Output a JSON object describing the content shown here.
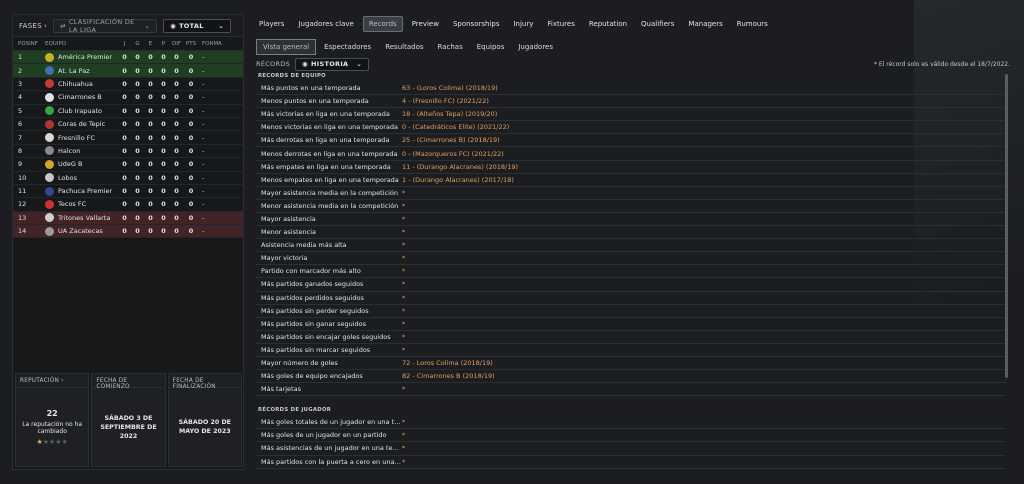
{
  "left": {
    "fases_label": "FASES",
    "stage_dropdown": "CLASIFICACIÓN DE LA LIGA",
    "total_dropdown": "TOTAL",
    "columns": [
      "POS",
      "INF",
      "EQUIPO",
      "J",
      "G",
      "E",
      "P",
      "DIF",
      "PTS",
      "FORMA"
    ],
    "rows": [
      {
        "pos": "1",
        "team": "América Premier",
        "j": "0",
        "g": "0",
        "e": "0",
        "p": "0",
        "dif": "0",
        "pts": "0",
        "form": "-",
        "zone": "green",
        "crest": "#c8b02a"
      },
      {
        "pos": "2",
        "team": "At. La Paz",
        "j": "0",
        "g": "0",
        "e": "0",
        "p": "0",
        "dif": "0",
        "pts": "0",
        "form": "-",
        "zone": "green",
        "crest": "#3f6fb5"
      },
      {
        "pos": "3",
        "team": "Chihuahua",
        "j": "0",
        "g": "0",
        "e": "0",
        "p": "0",
        "dif": "0",
        "pts": "0",
        "form": "-",
        "zone": "",
        "crest": "#c23a3a"
      },
      {
        "pos": "4",
        "team": "Cimarrones B",
        "j": "0",
        "g": "0",
        "e": "0",
        "p": "0",
        "dif": "0",
        "pts": "0",
        "form": "-",
        "zone": "",
        "crest": "#e0e0e0"
      },
      {
        "pos": "5",
        "team": "Club Irapuato",
        "j": "0",
        "g": "0",
        "e": "0",
        "p": "0",
        "dif": "0",
        "pts": "0",
        "form": "-",
        "zone": "",
        "crest": "#3aa04a"
      },
      {
        "pos": "6",
        "team": "Coras de Tepic",
        "j": "0",
        "g": "0",
        "e": "0",
        "p": "0",
        "dif": "0",
        "pts": "0",
        "form": "-",
        "zone": "",
        "crest": "#b0342f"
      },
      {
        "pos": "7",
        "team": "Fresnillo FC",
        "j": "0",
        "g": "0",
        "e": "0",
        "p": "0",
        "dif": "0",
        "pts": "0",
        "form": "-",
        "zone": "",
        "crest": "#d9d9d9"
      },
      {
        "pos": "8",
        "team": "Halcon",
        "j": "0",
        "g": "0",
        "e": "0",
        "p": "0",
        "dif": "0",
        "pts": "0",
        "form": "-",
        "zone": "",
        "crest": "#8a8a8a"
      },
      {
        "pos": "9",
        "team": "UdeG B",
        "j": "0",
        "g": "0",
        "e": "0",
        "p": "0",
        "dif": "0",
        "pts": "0",
        "form": "-",
        "zone": "",
        "crest": "#d4a32b"
      },
      {
        "pos": "10",
        "team": "Lobos",
        "j": "0",
        "g": "0",
        "e": "0",
        "p": "0",
        "dif": "0",
        "pts": "0",
        "form": "-",
        "zone": "",
        "crest": "#c9c9c9"
      },
      {
        "pos": "11",
        "team": "Pachuca Premier",
        "j": "0",
        "g": "0",
        "e": "0",
        "p": "0",
        "dif": "0",
        "pts": "0",
        "form": "-",
        "zone": "",
        "crest": "#2e4a8c"
      },
      {
        "pos": "12",
        "team": "Tecos FC",
        "j": "0",
        "g": "0",
        "e": "0",
        "p": "0",
        "dif": "0",
        "pts": "0",
        "form": "-",
        "zone": "",
        "crest": "#c8332f"
      },
      {
        "pos": "13",
        "team": "Tritones Vallarta",
        "j": "0",
        "g": "0",
        "e": "0",
        "p": "0",
        "dif": "0",
        "pts": "0",
        "form": "-",
        "zone": "red",
        "crest": "#d0d0d0"
      },
      {
        "pos": "14",
        "team": "UA Zacatecas",
        "j": "0",
        "g": "0",
        "e": "0",
        "p": "0",
        "dif": "0",
        "pts": "0",
        "form": "-",
        "zone": "red",
        "crest": "#9b9b9b"
      }
    ],
    "reputation": {
      "title": "REPUTACIÓN",
      "value": "22",
      "text": "La reputación no ha cambiado",
      "stars_filled": 1,
      "stars_total": 5
    },
    "start": {
      "title": "FECHA DE COMIENZO",
      "value": "SÁBADO 3 DE SEPTIEMBRE DE 2022"
    },
    "end": {
      "title": "FECHA DE FINALIZACIÓN",
      "value": "SÁBADO 20 DE MAYO DE 2023"
    }
  },
  "tabs": [
    "Players",
    "Jugadores clave",
    "Records",
    "Preview",
    "Sponsorships",
    "Injury",
    "Fixtures",
    "Reputation",
    "Qualifiers",
    "Managers",
    "Rumours"
  ],
  "active_tab": 2,
  "subtabs": [
    "Vista general",
    "Espectadores",
    "Resultados",
    "Rachas",
    "Equipos",
    "Jugadores"
  ],
  "active_subtab": 0,
  "records_bar": {
    "label": "RÉCORDS",
    "dropdown": "HISTORIA",
    "note": "* El récord solo es válido desde el 18/7/2022."
  },
  "team_section": "RÉCORDS DE EQUIPO",
  "team_records": [
    {
      "label": "Más puntos en una temporada",
      "value": "63 - (Loros Colima) (2018/19)"
    },
    {
      "label": "Menos puntos en una temporada",
      "value": "4 - (Fresnillo FC) (2021/22)"
    },
    {
      "label": "Más victorias en liga en una temporada",
      "value": "18 - (Alteños Tepa) (2019/20)"
    },
    {
      "label": "Menos victorias en liga en una temporada",
      "value": "0 - (Catedráticos Elite) (2021/22)"
    },
    {
      "label": "Más derrotas en liga en una temporada",
      "value": "25 - (Cimarrones B) (2018/19)"
    },
    {
      "label": "Menos derrotas en liga en una temporada",
      "value": "0 - (Mazorqueros FC) (2021/22)"
    },
    {
      "label": "Más empates en liga en una temporada",
      "value": "11 - (Durango Alacranes) (2018/19)"
    },
    {
      "label": "Menos empates en liga en una temporada",
      "value": "1 - (Durango Alacranes) (2017/18)"
    },
    {
      "label": "Mayor asistencia media en la competición",
      "value": "*"
    },
    {
      "label": "Menor asistencia media en la competición",
      "value": "*"
    },
    {
      "label": "Mayor asistencia",
      "value": "*"
    },
    {
      "label": "Menor asistencia",
      "value": "*"
    },
    {
      "label": "Asistencia media más alta",
      "value": "*"
    },
    {
      "label": "Mayor victoria",
      "value": "*"
    },
    {
      "label": "Partido con marcador más alto",
      "value": "*"
    },
    {
      "label": "Más partidos ganados seguidos",
      "value": "*"
    },
    {
      "label": "Más partidos perdidos seguidos",
      "value": "*"
    },
    {
      "label": "Más partidos sin perder seguidos",
      "value": "*"
    },
    {
      "label": "Más partidos sin ganar seguidos",
      "value": "*"
    },
    {
      "label": "Más partidos sin encajar goles seguidos",
      "value": "*"
    },
    {
      "label": "Más partidos sin marcar seguidos",
      "value": "*"
    },
    {
      "label": "Mayor número de goles",
      "value": "72 - Loros Colima (2018/19)"
    },
    {
      "label": "Más goles de equipo encajados",
      "value": "82 - Cimarrones B (2018/19)"
    },
    {
      "label": "Más tarjetas",
      "value": "*"
    }
  ],
  "player_section": "RÉCORDS DE JUGADOR",
  "player_records": [
    {
      "label": "Más goles totales de un jugador en una tem...",
      "value": "*"
    },
    {
      "label": "Más goles de un jugador en un partido",
      "value": "*"
    },
    {
      "label": "Más asistencias de un jugador en una temp...",
      "value": "*"
    },
    {
      "label": "Más partidos con la puerta a cero en una te...",
      "value": "*"
    }
  ]
}
